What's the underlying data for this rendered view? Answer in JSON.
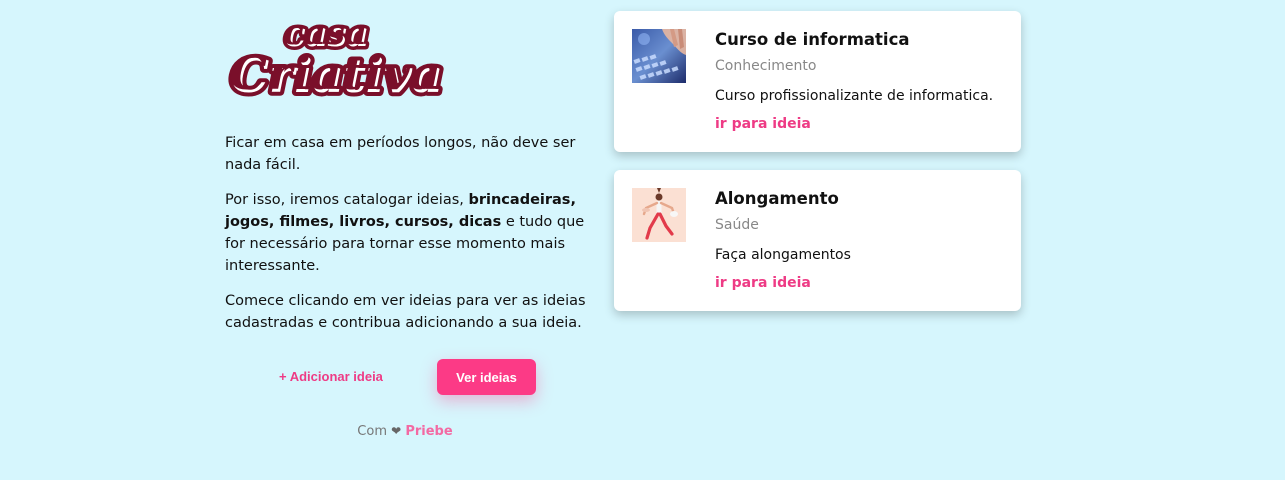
{
  "logo": {
    "line1": "casa",
    "line2": "Criativa",
    "color": "#7a0f2a"
  },
  "intro": {
    "p1": "Ficar em casa em períodos longos, não deve ser nada fácil.",
    "p2_before": "Por isso, iremos catalogar ideias, ",
    "p2_bold": "brincadeiras, jogos, filmes, livros, cursos, dicas",
    "p2_after": " e tudo que for necessário para tornar esse momento mais interessante.",
    "p3": "Comece clicando em ver ideias para ver as ideias cadastradas e contribua adicionando a sua ideia."
  },
  "actions": {
    "add_label": "+ Adicionar ideia",
    "view_label": "Ver ideias"
  },
  "footer": {
    "prefix": "Com",
    "heart": "❤",
    "author": "Priebe"
  },
  "cards": [
    {
      "title": "Curso de informatica",
      "category": "Conhecimento",
      "description": "Curso profissionalizante de informatica.",
      "link": "ir para ideia",
      "icon": "keyboard-photo"
    },
    {
      "title": "Alongamento",
      "category": "Saúde",
      "description": "Faça alongamentos",
      "link": "ir para ideia",
      "icon": "stretching-photo"
    }
  ],
  "colors": {
    "background": "#d6f6fd",
    "accent": "#fc3a86",
    "logo": "#7a0f2a"
  }
}
